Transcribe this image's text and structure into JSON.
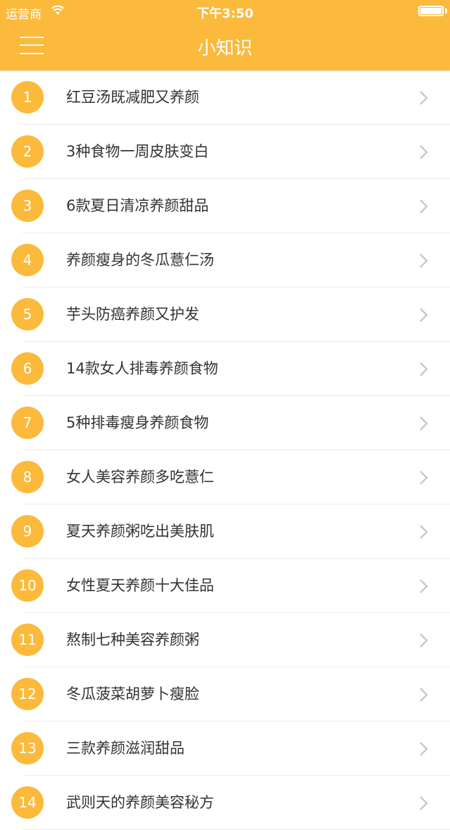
{
  "status_bar": {
    "carrier": "运营商",
    "time": "下午3:50",
    "battery_level": 1.0
  },
  "nav": {
    "title": "小知识",
    "menu_icon": "hamburger-menu-icon"
  },
  "colors": {
    "accent": "#fbba3c",
    "text": "#333333",
    "chevron": "#c7c7cc"
  },
  "items": [
    {
      "number": "1",
      "title": "红豆汤既减肥又养颜"
    },
    {
      "number": "2",
      "title": "3种食物一周皮肤变白"
    },
    {
      "number": "3",
      "title": "6款夏日清凉养颜甜品"
    },
    {
      "number": "4",
      "title": "养颜瘦身的冬瓜薏仁汤"
    },
    {
      "number": "5",
      "title": "芋头防癌养颜又护发"
    },
    {
      "number": "6",
      "title": "14款女人排毒养颜食物"
    },
    {
      "number": "7",
      "title": "5种排毒瘦身养颜食物"
    },
    {
      "number": "8",
      "title": "女人美容养颜多吃薏仁"
    },
    {
      "number": "9",
      "title": "夏天养颜粥吃出美肤肌"
    },
    {
      "number": "10",
      "title": "女性夏天养颜十大佳品"
    },
    {
      "number": "11",
      "title": "熬制七种美容养颜粥"
    },
    {
      "number": "12",
      "title": "冬瓜菠菜胡萝卜瘦脸"
    },
    {
      "number": "13",
      "title": "三款养颜滋润甜品"
    },
    {
      "number": "14",
      "title": "武则天的养颜美容秘方"
    }
  ]
}
